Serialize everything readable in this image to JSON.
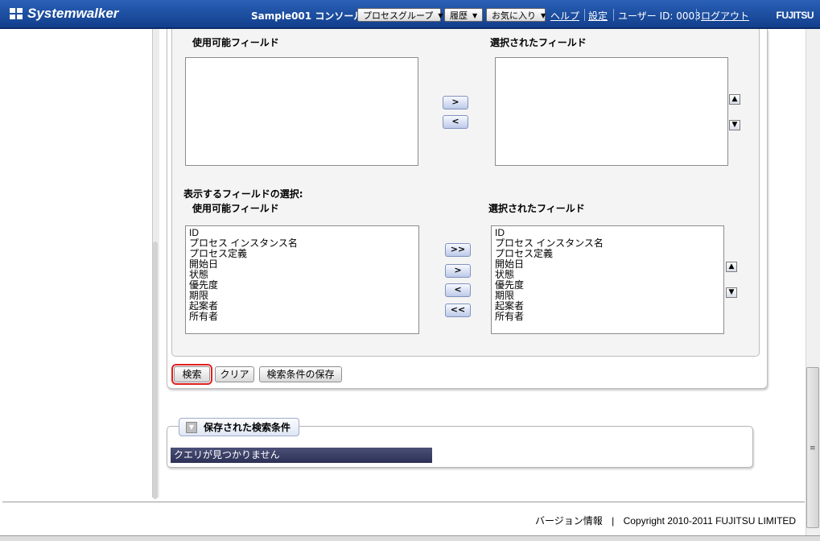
{
  "header": {
    "logo": "Systemwalker",
    "console": "Sample001 コンソール",
    "menus": [
      {
        "label": "プロセスグループ"
      },
      {
        "label": "履歴"
      },
      {
        "label": "お気に入り"
      }
    ],
    "help": "ヘルプ",
    "settings": "設定",
    "user": "ユーザー ID: 0003",
    "logout": "ログアウト",
    "brand": "FUJITSU"
  },
  "upper_selector": {
    "available_label": "使用可能フィールド",
    "selected_label": "選択されたフィールド",
    "add": ">",
    "remove": "<"
  },
  "display_selector": {
    "section_label": "表示するフィールドの選択:",
    "available_label": "使用可能フィールド",
    "selected_label": "選択されたフィールド",
    "available_items": [
      "ID",
      "プロセス インスタンス名",
      "プロセス定義",
      "開始日",
      "状態",
      "優先度",
      "期限",
      "起案者",
      "所有者"
    ],
    "selected_items": [
      "ID",
      "プロセス インスタンス名",
      "プロセス定義",
      "開始日",
      "状態",
      "優先度",
      "期限",
      "起案者",
      "所有者"
    ],
    "add_all": ">>",
    "add": ">",
    "remove": "<",
    "remove_all": "<<"
  },
  "actions": {
    "search": "検索",
    "clear": "クリア",
    "save": "検索条件の保存"
  },
  "saved": {
    "title": "保存された検索条件",
    "empty": "クエリが見つかりません"
  },
  "footer": {
    "version": "バージョン情報",
    "separator": "|",
    "copyright": "Copyright 2010-2011 FUJITSU LIMITED"
  }
}
